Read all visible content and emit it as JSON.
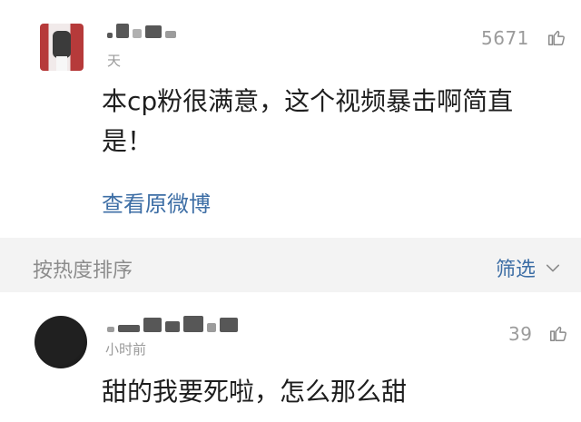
{
  "post": {
    "time": "天",
    "likes": "5671",
    "text": "本cp粉很满意，这个视频暴击啊简直是！",
    "view_link": "查看原微博"
  },
  "sort_bar": {
    "sort_label": "按热度排序",
    "filter_label": "筛选"
  },
  "comment": {
    "time": "小时前",
    "likes": "39",
    "text": "甜的我要死啦，怎么那么甜"
  },
  "icons": {
    "like": "thumbs-up-icon",
    "chevron": "chevron-down-icon"
  },
  "colors": {
    "link": "#3d6ea5",
    "muted": "#9a9a9a",
    "sort_bg": "#f3f3f3"
  }
}
